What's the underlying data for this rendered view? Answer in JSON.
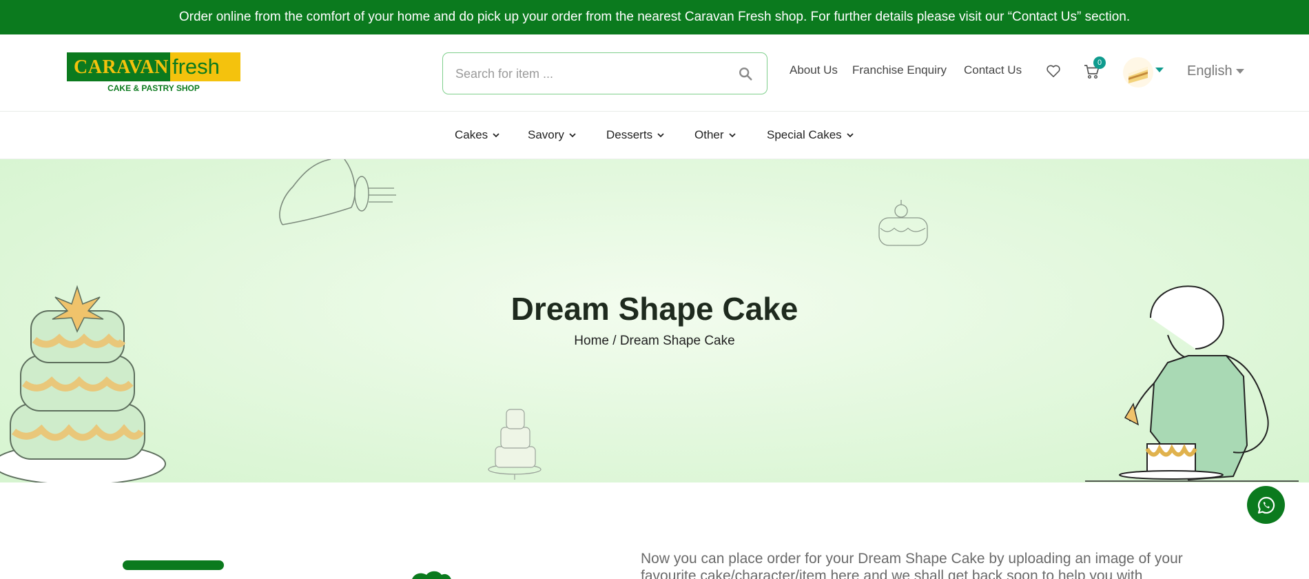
{
  "promo": {
    "text": "Order online from the comfort of your home and do pick up your order from the nearest Caravan Fresh shop. For further details please visit our “Contact Us” section."
  },
  "header": {
    "logo": {
      "word1": "CARAVAN",
      "word2": "fresh",
      "tagline": "CAKE & PASTRY SHOP"
    },
    "search": {
      "placeholder": "Search for item ...",
      "icon": "search-icon"
    },
    "nav": {
      "about": "About Us",
      "franchise": "Franchise Enquiry",
      "contact": "Contact Us"
    },
    "wishlist_icon": "heart-icon",
    "cart": {
      "icon": "cart-icon",
      "count": "0"
    },
    "account_icon": "cake-avatar",
    "language": "English"
  },
  "categories": [
    {
      "label": "Cakes"
    },
    {
      "label": "Savory"
    },
    {
      "label": "Desserts"
    },
    {
      "label": "Other"
    },
    {
      "label": "Special Cakes"
    }
  ],
  "hero": {
    "title": "Dream Shape Cake",
    "breadcrumb": {
      "home": "Home",
      "separator": " / ",
      "current": "Dream Shape Cake"
    }
  },
  "content": {
    "intro": "Now you can place order for your Dream Shape Cake by uploading an image of your favourite cake/character/item here and we shall get back soon to help you with"
  },
  "colors": {
    "brand_green": "#0b7a1e",
    "brand_yellow": "#f4c20d",
    "badge_teal": "#0f9b8e",
    "hero_bg": "#e6f9e1"
  }
}
